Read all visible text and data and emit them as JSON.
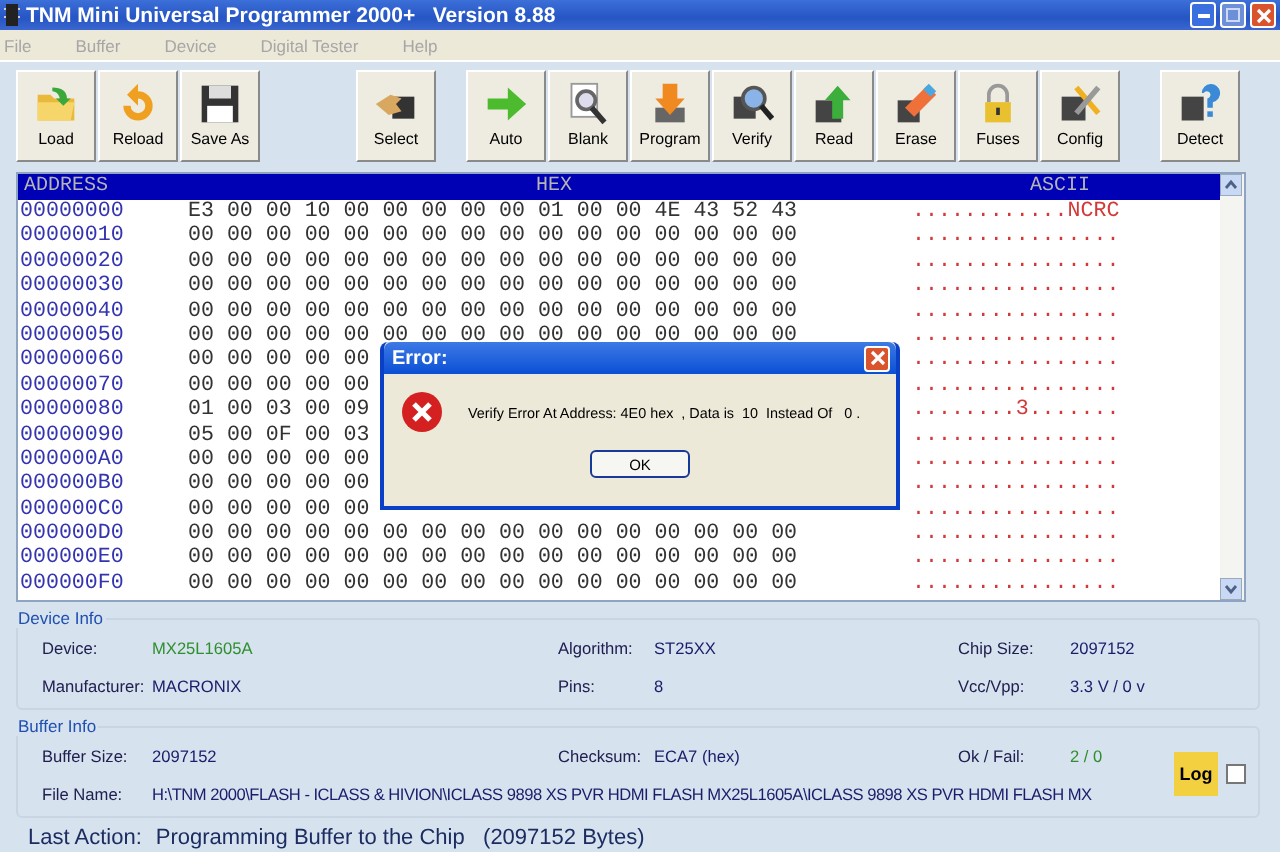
{
  "window": {
    "title": "TNM Mini Universal Programmer 2000+   Version 8.88"
  },
  "menu": [
    {
      "label": "File"
    },
    {
      "label": "Buffer"
    },
    {
      "label": "Device"
    },
    {
      "label": "Digital Tester"
    },
    {
      "label": "Help"
    }
  ],
  "toolbar": [
    [
      {
        "label": "Load",
        "kind": "folder"
      },
      {
        "label": "Reload",
        "kind": "reload"
      },
      {
        "label": "Save As",
        "kind": "floppy"
      }
    ],
    [
      {
        "label": "Select",
        "kind": "select"
      }
    ],
    [
      {
        "label": "Auto",
        "kind": "arrow"
      },
      {
        "label": "Blank",
        "kind": "magnifier"
      },
      {
        "label": "Program",
        "kind": "program"
      },
      {
        "label": "Verify",
        "kind": "verify"
      },
      {
        "label": "Read",
        "kind": "read"
      },
      {
        "label": "Erase",
        "kind": "erase"
      },
      {
        "label": "Fuses",
        "kind": "lock"
      },
      {
        "label": "Config",
        "kind": "tools"
      }
    ],
    [
      {
        "label": "Detect",
        "kind": "detect"
      }
    ]
  ],
  "hex_view": {
    "columns": [
      "ADDRESS",
      "HEX",
      "ASCII"
    ],
    "rows": [
      {
        "address": "00000000",
        "hex": "E3 00 00 10 00 00 00 00 00 01 00 00 4E 43 52 43",
        "ascii": "............NCRC"
      },
      {
        "address": "00000010",
        "hex": "00 00 00 00 00 00 00 00 00 00 00 00 00 00 00 00",
        "ascii": "................"
      },
      {
        "address": "00000020",
        "hex": "00 00 00 00 00 00 00 00 00 00 00 00 00 00 00 00",
        "ascii": "................"
      },
      {
        "address": "00000030",
        "hex": "00 00 00 00 00 00 00 00 00 00 00 00 00 00 00 00",
        "ascii": "................"
      },
      {
        "address": "00000040",
        "hex": "00 00 00 00 00 00 00 00 00 00 00 00 00 00 00 00",
        "ascii": "................"
      },
      {
        "address": "00000050",
        "hex": "00 00 00 00 00 00 00 00 00 00 00 00 00 00 00 00",
        "ascii": "................"
      },
      {
        "address": "00000060",
        "hex": "00 00 00 00 00",
        "ascii": "................"
      },
      {
        "address": "00000070",
        "hex": "00 00 00 00 00",
        "ascii": "................"
      },
      {
        "address": "00000080",
        "hex": "01 00 03 00 09",
        "ascii": "........3......."
      },
      {
        "address": "00000090",
        "hex": "05 00 0F 00 03",
        "ascii": "................"
      },
      {
        "address": "000000A0",
        "hex": "00 00 00 00 00",
        "ascii": "................"
      },
      {
        "address": "000000B0",
        "hex": "00 00 00 00 00",
        "ascii": "................"
      },
      {
        "address": "000000C0",
        "hex": "00 00 00 00 00",
        "ascii": "................"
      },
      {
        "address": "000000D0",
        "hex": "00 00 00 00 00 00 00 00 00 00 00 00 00 00 00 00",
        "ascii": "................"
      },
      {
        "address": "000000E0",
        "hex": "00 00 00 00 00 00 00 00 00 00 00 00 00 00 00 00",
        "ascii": "................"
      },
      {
        "address": "000000F0",
        "hex": "00 00 00 00 00 00 00 00 00 00 00 00 00 00 00 00",
        "ascii": "................"
      }
    ]
  },
  "dialog": {
    "title": "Error:",
    "message": "Verify Error At Address: 4E0 hex  , Data is  10  Instead Of   0 .",
    "button": "OK"
  },
  "device_info": {
    "title": "Device Info",
    "fields": [
      {
        "label": "Device:",
        "value": "MX25L1605A",
        "color": "#2f8f2f"
      },
      {
        "label": "Algorithm:",
        "value": "ST25XX",
        "color": "#1c1c6a"
      },
      {
        "label": "Chip Size:",
        "value": "2097152",
        "color": "#1c1c6a"
      },
      {
        "label": "Manufacturer:",
        "value": "MACRONIX",
        "color": "#1c1c6a"
      },
      {
        "label": "Pins:",
        "value": "8",
        "color": "#1c1c6a"
      },
      {
        "label": "Vcc/Vpp:",
        "value": "3.3 V / 0 v",
        "color": "#1c1c6a"
      }
    ]
  },
  "buffer_info": {
    "title": "Buffer Info",
    "fields": [
      {
        "label": "Buffer Size:",
        "value": "2097152",
        "color": "#1c1c6a"
      },
      {
        "label": "Checksum:",
        "value": "ECA7 (hex)",
        "color": "#1c1c6a"
      },
      {
        "label": "Ok / Fail:",
        "value": "2 / 0",
        "color": "#2f8f2f"
      }
    ],
    "file_name": {
      "label": "File Name:",
      "value": "H:\\TNM 2000\\FLASH - ICLASS & HIVION\\ICLASS 9898 XS PVR HDMI FLASH MX25L1605A\\ICLASS 9898 XS PVR HDMI FLASH MX"
    },
    "log": {
      "label": "Log",
      "checked": false
    }
  },
  "status": {
    "label": "Last Action:",
    "value": "Programming Buffer to the Chip   (2097152 Bytes)"
  }
}
